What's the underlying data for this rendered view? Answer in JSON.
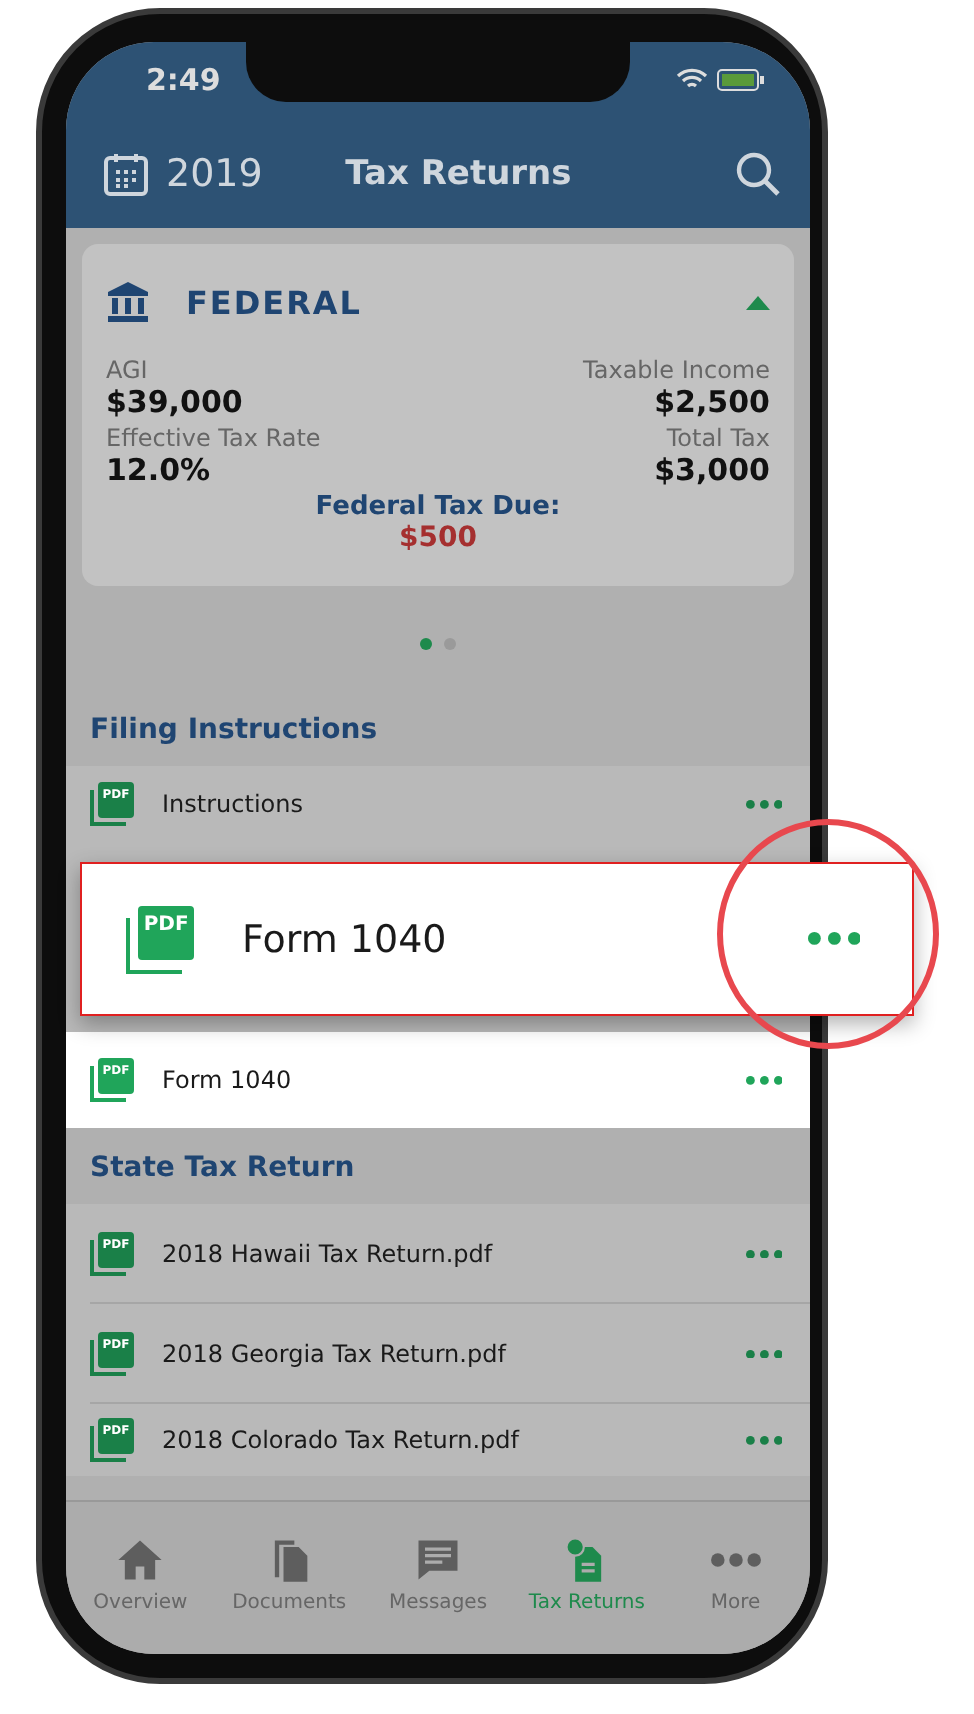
{
  "status_bar": {
    "time": "2:49"
  },
  "header": {
    "year": "2019",
    "title": "Tax Returns"
  },
  "federal_card": {
    "title": "FEDERAL",
    "expanded": true,
    "stats": [
      {
        "label": "AGI",
        "value": "$39,000"
      },
      {
        "label": "Taxable Income",
        "value": "$2,500"
      },
      {
        "label": "Effective Tax Rate",
        "value": "12.0%"
      },
      {
        "label": "Total Tax",
        "value": "$3,000"
      }
    ],
    "due_label": "Federal Tax Due:",
    "due_value": "$500"
  },
  "pager": [
    {
      "selected": true
    },
    {
      "selected": false
    }
  ],
  "sections": [
    {
      "title": "Filing Instructions",
      "files": [
        {
          "name": "Instructions",
          "badge": "PDF",
          "highlighted": false
        },
        {
          "kind": "hidden"
        },
        {
          "name": "Form 1040",
          "badge": "PDF",
          "highlighted": true
        }
      ]
    },
    {
      "title": "State Tax Return",
      "files": [
        {
          "name": "2018 Hawaii Tax Return.pdf",
          "badge": "PDF",
          "highlighted": false
        },
        {
          "name": "2018 Georgia Tax Return.pdf",
          "badge": "PDF",
          "highlighted": false
        },
        {
          "name": "2018 Colorado Tax Return.pdf",
          "badge": "PDF",
          "highlighted": false
        }
      ]
    }
  ],
  "tab_bar": [
    {
      "label": "Overview",
      "selected": false
    },
    {
      "label": "Documents",
      "selected": false
    },
    {
      "label": "Messages",
      "selected": false
    },
    {
      "label": "Tax Returns",
      "selected": true
    },
    {
      "label": "More",
      "selected": false
    }
  ],
  "callout": {
    "name": "Form 1040",
    "badge": "PDF"
  }
}
